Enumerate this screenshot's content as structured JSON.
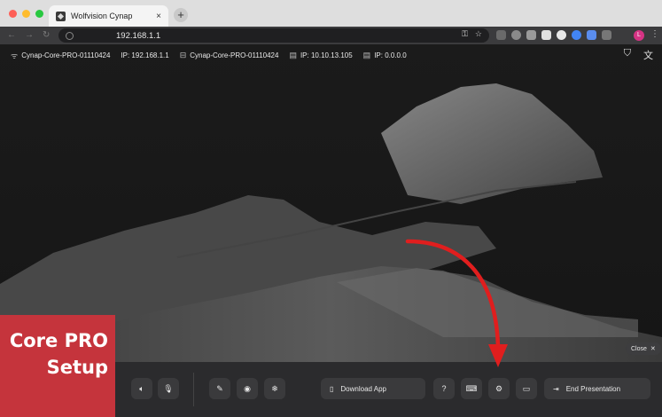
{
  "browser": {
    "tab_title": "Wolfvision Cynap",
    "tab_close": "×",
    "new_tab": "+",
    "url": "192.168.1.1",
    "nav": [
      "←",
      "→",
      "↻"
    ],
    "url_icons": [
      "key-icon",
      "star-icon"
    ],
    "profile_initial": "L",
    "colors": {
      "close": "#fe5f57",
      "minimize": "#febc2e",
      "maximize": "#28c840"
    }
  },
  "status_bar": {
    "wifi_name": "Cynap-Core-PRO-01110424",
    "wifi_ip": "IP: 192.168.1.1",
    "lan1_name": "Cynap-Core-PRO-01110424",
    "lan1_ip": "IP: 10.10.13.105",
    "lan2_ip": "IP: 0.0.0.0"
  },
  "close_pill": {
    "label": "Close",
    "icon": "✕"
  },
  "bottom_bar": {
    "download_app": "Download App",
    "end_presentation": "End Presentation",
    "icons": [
      "volume-icon",
      "microphone-icon",
      "annotation-pen-icon",
      "camera-icon",
      "freeze-icon",
      "help-icon",
      "keyboard-icon",
      "settings-icon",
      "screen-icon"
    ]
  },
  "badge": {
    "line1": "Core PRO",
    "line2": "Setup"
  },
  "accent_colors": {
    "badge": "#c5343c",
    "arrow": "#e01e1e"
  }
}
